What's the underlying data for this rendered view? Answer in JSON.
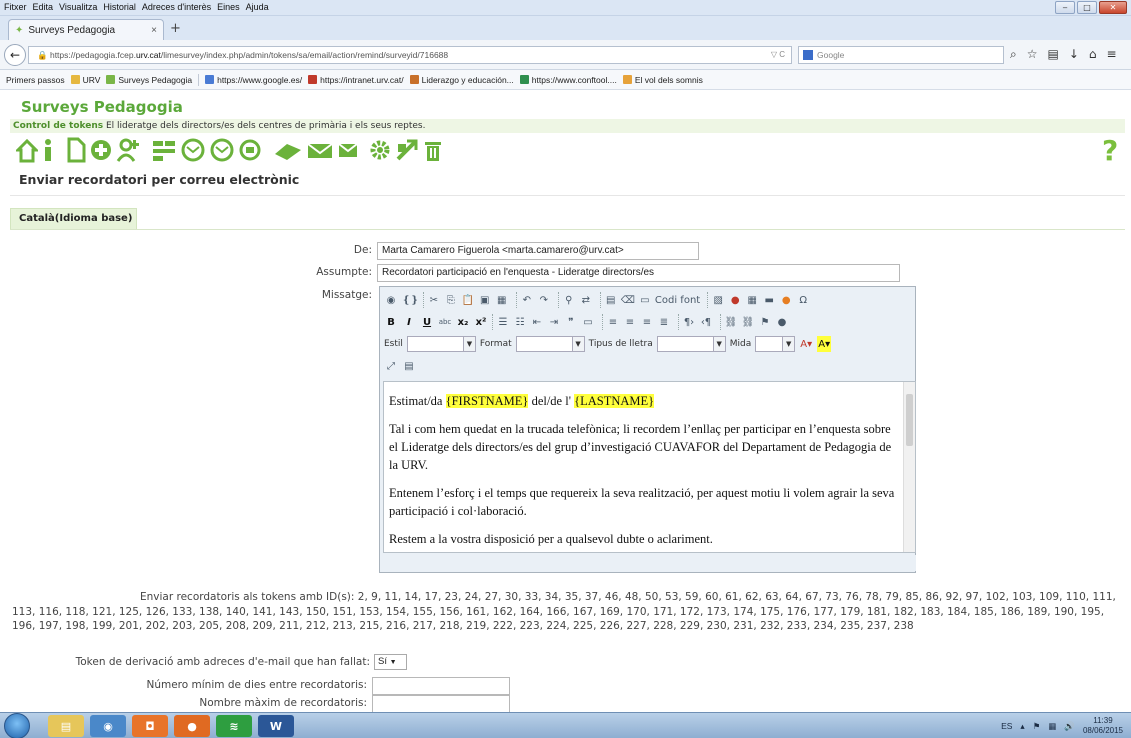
{
  "browser": {
    "menu": [
      "Fitxer",
      "Edita",
      "Visualitza",
      "Historial",
      "Adreces d'interès",
      "Eines",
      "Ajuda"
    ],
    "tab_title": "Surveys Pedagogia",
    "tab_close": "×",
    "new_tab": "+",
    "url_prefix": "https://pedagogia.fcep.",
    "url_domain": "urv.cat",
    "url_path": "/limesurvey/index.php/admin/tokens/sa/email/action/remind/surveyid/716688",
    "url_right": "▽ C",
    "search_placeholder": "Google",
    "bookmarks": [
      {
        "label": "Primers passos",
        "color": "#f4b53c"
      },
      {
        "label": "URV",
        "color": "#e6b840"
      },
      {
        "label": "Surveys Pedagogia",
        "color": "#7ab648"
      },
      {
        "label": "https://www.google.es/",
        "color": "#4a7bd4"
      },
      {
        "label": "https://intranet.urv.cat/",
        "color": "#c0392b"
      },
      {
        "label": "Liderazgo y educación...",
        "color": "#c8702a"
      },
      {
        "label": "https://www.conftool....",
        "color": "#2f8f4e"
      },
      {
        "label": "El vol dels somnis",
        "color": "#e6a23a"
      }
    ]
  },
  "site": {
    "title": "Surveys Pedagogia",
    "token_control_label": "Control de tokens",
    "survey_name": "El lideratge dels directors/es dels centres de primària i els seus reptes.",
    "help": "?",
    "section_title": "Enviar recordatori per correu electrònic",
    "lang_tab": "Català(Idioma base)"
  },
  "form": {
    "from_label": "De:",
    "from_value": "Marta Camarero Figuerola <marta.camarero@urv.cat>",
    "subject_label": "Assumpte:",
    "subject_value": "Recordatori participació en l'enquesta - Lideratge directors/es",
    "message_label": "Missatge:",
    "editor": {
      "codi_font": "Codi font",
      "estil_label": "Estil",
      "format_label": "Format",
      "font_label": "Tipus de lletra",
      "size_label": "Mida"
    },
    "body": {
      "greeting_pre": "Estimat/da ",
      "firstname": "{FIRSTNAME}",
      "greeting_mid": " del/de l' ",
      "lastname": "{LASTNAME}",
      "para1": "Tal i com hem quedat en la trucada telefònica; li recordem l’enllaç per participar en l’enquesta sobre el Lideratge dels directors/es del grup d’investigació CUAVAFOR del Departament de Pedagogia de la URV.",
      "para2": "Entenem l’esforç i el temps que requereix la seva realització, per aquest motiu li volem agrair la seva participació i col·laboració.",
      "para3": "Restem a la vostra disposició per a qualsevol dubte o aclariment."
    },
    "ids_label": "Enviar recordatoris als tokens amb ID(s):",
    "ids_value": "2, 9, 11, 14, 17, 23, 24, 27, 30, 33, 34, 35, 37, 46, 48, 50, 53, 59, 60, 61, 62, 63, 64, 67, 73, 76, 78, 79, 85, 86, 92, 97, 102, 103, 109, 110, 111, 113, 116, 118, 121, 125, 126, 133, 138, 140, 141, 143, 150, 151, 153, 154, 155, 156, 161, 162, 164, 166, 167, 169, 170, 171, 172, 173, 174, 175, 176, 177, 179, 181, 182, 183, 184, 185, 186, 189, 190, 195, 196, 197, 198, 199, 201, 202, 203, 205, 208, 209, 211, 212, 213, 215, 216, 217, 218, 219, 222, 223, 224, 225, 226, 227, 228, 229, 230, 231, 232, 233, 234, 235, 237, 238",
    "bypass_label": "Token de derivació amb adreces d'e-mail que han fallat:",
    "bypass_value": "Sí",
    "min_days_label": "Número mínim de dies entre recordatoris:",
    "max_reminders_label": "Nombre màxim de recordatoris:"
  },
  "taskbar": {
    "lang": "ES",
    "time": "11:39",
    "date": "08/06/2015"
  }
}
